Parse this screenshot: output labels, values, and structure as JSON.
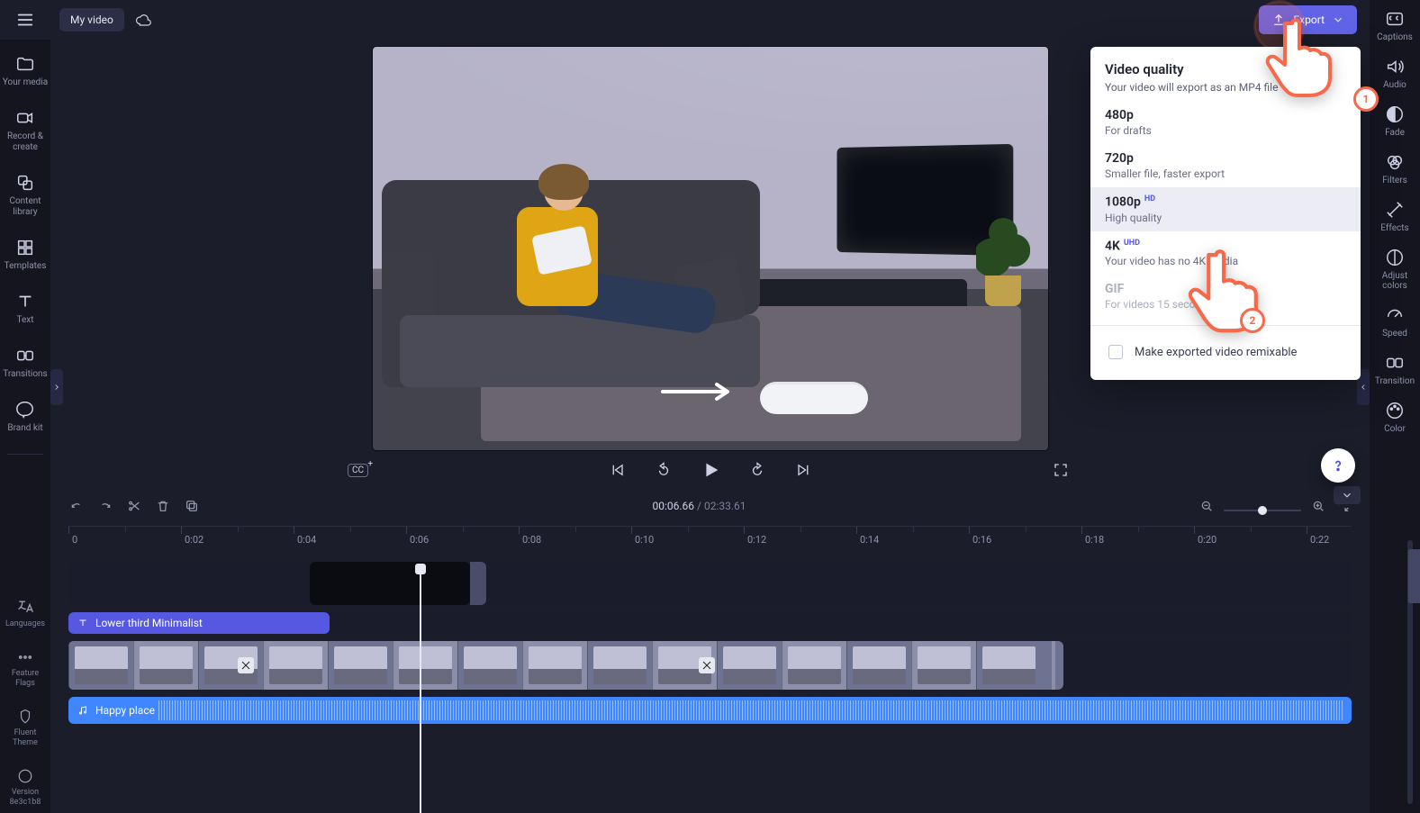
{
  "app": {
    "title": "My video"
  },
  "header": {
    "export_label": "Export"
  },
  "sidebar_left": {
    "items": [
      {
        "id": "your-media",
        "label": "Your media"
      },
      {
        "id": "record",
        "label": "Record &\ncreate"
      },
      {
        "id": "content-library",
        "label": "Content\nlibrary"
      },
      {
        "id": "templates",
        "label": "Templates"
      },
      {
        "id": "text",
        "label": "Text"
      },
      {
        "id": "transitions",
        "label": "Transitions"
      },
      {
        "id": "brand-kit",
        "label": "Brand kit"
      }
    ],
    "secondary": [
      {
        "id": "languages",
        "label": "Languages"
      },
      {
        "id": "feature-flags",
        "label": "Feature\nFlags"
      },
      {
        "id": "fluent-theme",
        "label": "Fluent\nTheme"
      },
      {
        "id": "version",
        "label": "Version\n8e3c1b8"
      }
    ]
  },
  "sidebar_right": {
    "items": [
      {
        "id": "captions",
        "label": "Captions"
      },
      {
        "id": "audio",
        "label": "Audio"
      },
      {
        "id": "fade",
        "label": "Fade"
      },
      {
        "id": "filters",
        "label": "Filters"
      },
      {
        "id": "effects",
        "label": "Effects"
      },
      {
        "id": "adjust-colors",
        "label": "Adjust\ncolors"
      },
      {
        "id": "speed",
        "label": "Speed"
      },
      {
        "id": "transition",
        "label": "Transition"
      },
      {
        "id": "color",
        "label": "Color"
      }
    ]
  },
  "playback": {
    "current_time": "00:06.66",
    "duration": "02:33.61"
  },
  "ruler": {
    "ticks": [
      "0",
      "0:02",
      "0:04",
      "0:06",
      "0:08",
      "0:10",
      "0:12",
      "0:14",
      "0:16",
      "0:18",
      "0:20",
      "0:22"
    ]
  },
  "tracks": {
    "title_clip_label": "Lower third Minimalist",
    "audio_clip_label": "Happy place"
  },
  "export_panel": {
    "title": "Video quality",
    "subtitle": "Your video will export as an MP4 file",
    "options": [
      {
        "id": "480p",
        "label": "480p",
        "desc": "For drafts",
        "badge": ""
      },
      {
        "id": "720p",
        "label": "720p",
        "desc": "Smaller file, faster export",
        "badge": ""
      },
      {
        "id": "1080p",
        "label": "1080p",
        "desc": "High quality",
        "badge": "HD",
        "selected": true
      },
      {
        "id": "4k",
        "label": "4K",
        "desc": "Your video has no 4K media",
        "badge": "UHD"
      },
      {
        "id": "gif",
        "label": "GIF",
        "desc": "For videos 15 seconds or less",
        "badge": "",
        "disabled": true
      }
    ],
    "remix_label": "Make exported video remixable"
  },
  "annotations": {
    "one": "1",
    "two": "2"
  }
}
